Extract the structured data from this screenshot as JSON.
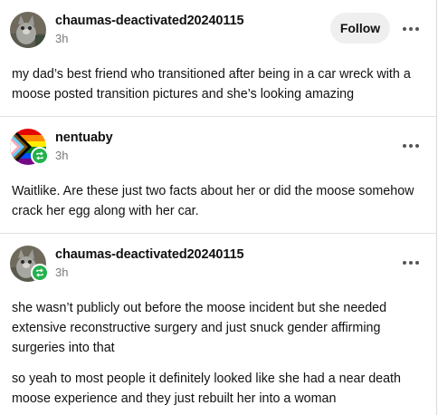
{
  "posts": [
    {
      "username": "chaumas-deactivated20240115",
      "time": "3h",
      "follow_label": "Follow",
      "reblog": false,
      "avatar": "cat-photo-avatar",
      "paragraphs": [
        "my dad’s best friend who transitioned after being in a car wreck with a moose posted transition pictures and she’s looking amazing"
      ]
    },
    {
      "username": "nentuaby",
      "time": "3h",
      "reblog": true,
      "avatar": "progress-pride-flag-avatar",
      "paragraphs": [
        "Waitlike. Are these just two facts about her or did the moose somehow crack her egg along with her car."
      ]
    },
    {
      "username": "chaumas-deactivated20240115",
      "time": "3h",
      "reblog": true,
      "avatar": "cat-photo-avatar",
      "paragraphs": [
        "she wasn’t publicly out before the moose incident but she needed extensive reconstructive surgery and just snuck gender affirming surgeries into that",
        "so yeah to most people it definitely looked like she had a near death moose experience and they just rebuilt her into a woman"
      ]
    }
  ],
  "icons": {
    "more": "more-horizontal-icon",
    "reblog": "reblog-icon"
  },
  "colors": {
    "reblog_badge": "#22b24c",
    "follow_bg": "#efefef",
    "divider": "#e3e3e3",
    "timestamp": "#7a7a7a"
  }
}
